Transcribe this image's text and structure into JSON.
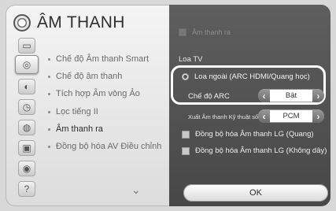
{
  "header": {
    "title": "ÂM THANH"
  },
  "left_menu": {
    "items": [
      {
        "label": "Chế độ Âm thanh Smart"
      },
      {
        "label": "Chế độ âm thanh"
      },
      {
        "label": "Tích hợp Âm vòng Ảo"
      },
      {
        "label": "Lọc tiếng II"
      },
      {
        "label": "Âm thanh ra",
        "active": true
      },
      {
        "label": "Đồng bộ hóa AV Điều chỉnh"
      }
    ]
  },
  "right_panel": {
    "disabled_option": "Âm thanh ra",
    "section_label": "Loa TV",
    "radio_option": "Loa ngoài (ARC HDMI/Quang học)",
    "arc_mode": {
      "label": "Chế độ ARC",
      "value": "Bật"
    },
    "digital_output": {
      "label": "Xuất Âm thanh Kỹ thuật số",
      "value": "PCM"
    },
    "checkboxes": [
      {
        "label": "Đồng bộ hóa Âm thanh LG (Quang)"
      },
      {
        "label": "Đồng bộ hóa Âm thanh LG (Không dây)"
      }
    ],
    "ok_label": "OK"
  },
  "icons": [
    "speaker-icon",
    "sound-icon",
    "effect-icon",
    "clock-icon",
    "lock-icon",
    "briefcase-icon",
    "globe-icon",
    "help-icon"
  ]
}
